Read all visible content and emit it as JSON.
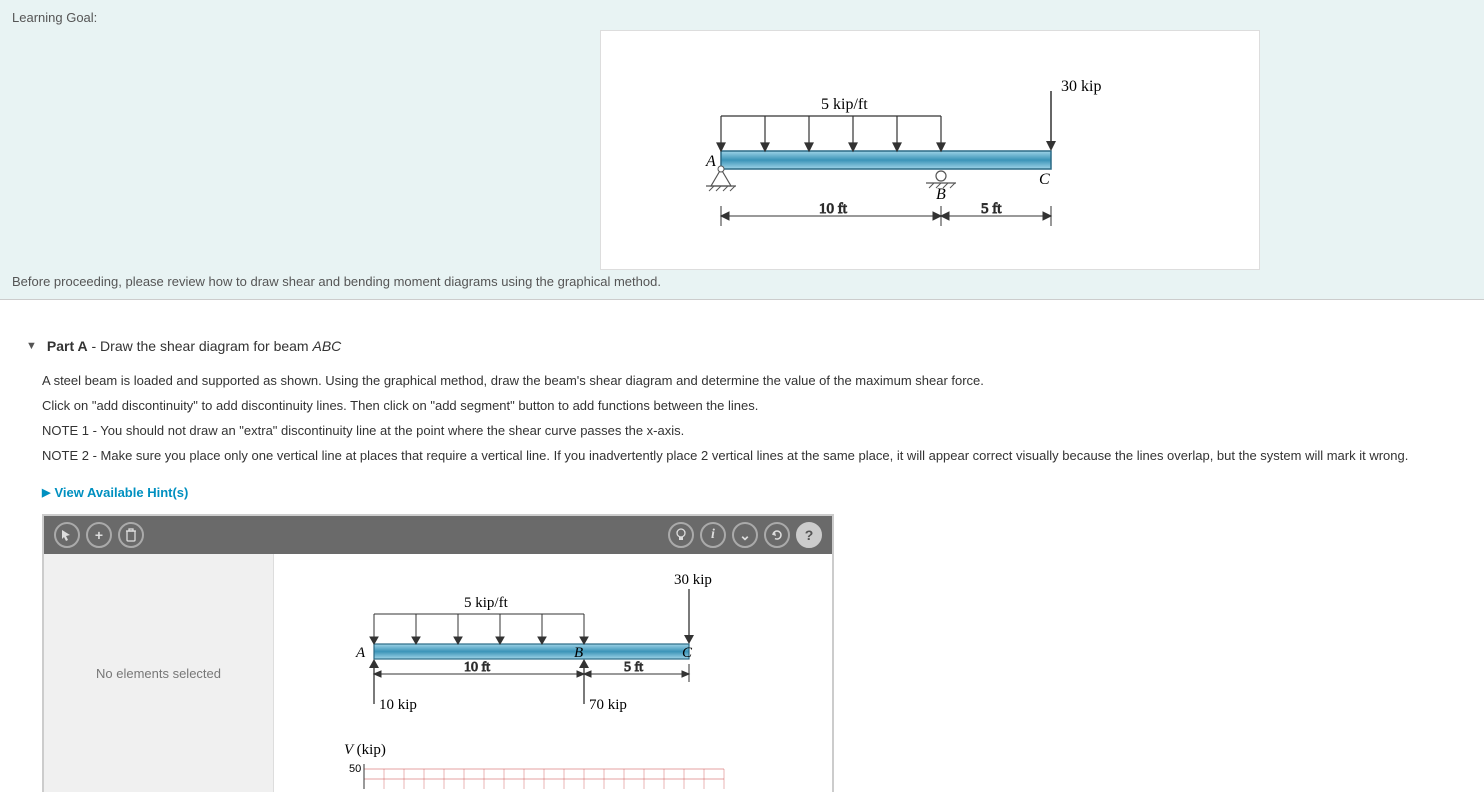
{
  "header": {
    "learning_goal_label": "Learning Goal:",
    "before_proceeding": "Before proceeding, please review how to draw shear and bending moment diagrams using the graphical method."
  },
  "figure_main": {
    "dist_load_label": "5 kip/ft",
    "point_load_label": "30 kip",
    "pt_A": "A",
    "pt_B": "B",
    "pt_C": "C",
    "dim1": "10 ft",
    "dim2": "5 ft"
  },
  "part": {
    "label": "Part A",
    "title_prefix": " - Draw the shear diagram for beam ",
    "title_beam": "ABC"
  },
  "instr": {
    "p1": "A steel beam is loaded and supported as shown. Using the graphical method, draw the beam's shear diagram and determine the value of the maximum shear force.",
    "p2": "Click on \"add discontinuity\" to add discontinuity lines. Then click on \"add segment\" button to add functions between the lines.",
    "p3": "NOTE 1 - You should not draw an \"extra\" discontinuity line at the point where the shear curve passes the x-axis.",
    "p4": "NOTE 2 - Make sure you place only one vertical line at places that require a vertical line. If you inadvertently place 2 vertical lines at the same place, it will appear correct visually because the lines overlap, but the system will mark it wrong."
  },
  "hints_link": "View Available Hint(s)",
  "toolbar": {
    "edit": "✎",
    "add": "+",
    "trash": "🗑",
    "bulb": "💡",
    "info": "i",
    "expand": "⌄",
    "reset": "↻",
    "help": "?"
  },
  "sidepanel": {
    "status": "No elements selected"
  },
  "figure_tool": {
    "dist_load_label": "5 kip/ft",
    "point_load_label": "30 kip",
    "pt_A": "A",
    "pt_B": "B",
    "pt_C": "C",
    "dim1": "10 ft",
    "dim2": "5 ft",
    "react_A": "10 kip",
    "react_B": "70 kip",
    "y_axis_label": "V (kip)",
    "tick50": "50"
  }
}
